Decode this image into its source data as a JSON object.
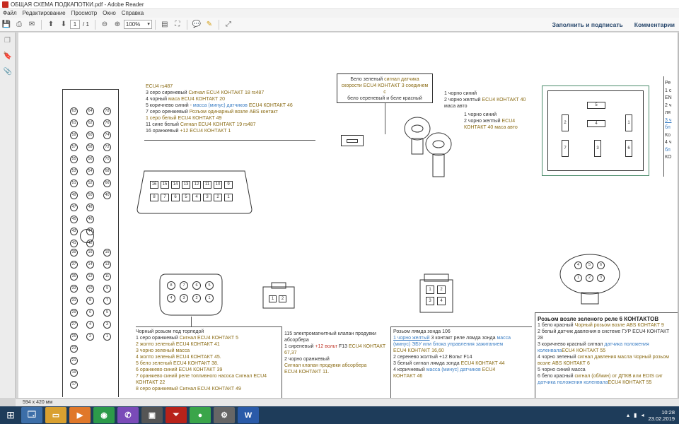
{
  "window": {
    "title": "ОБЩАЯ СХЕМА ПОДКАПОТКИ.pdf - Adobe Reader"
  },
  "menu": [
    "Файл",
    "Редактирование",
    "Просмотр",
    "Окно",
    "Справка"
  ],
  "toolbar": {
    "page_current": "1",
    "page_total": "/ 1",
    "zoom": "100%",
    "fill_sign": "Заполнить и подписать",
    "comments": "Комментарии"
  },
  "status": {
    "size": "594 x 420 мм"
  },
  "clock": {
    "time": "10:28",
    "date": "23.02.2019"
  },
  "doc": {
    "bigconn_left": [
      "63",
      "61",
      "59",
      "57",
      "55",
      "53",
      "51",
      "49",
      "47",
      "45",
      "43",
      "41"
    ],
    "bigconn_mid": [
      "64",
      "62",
      "60",
      "58",
      "56",
      "54",
      "52",
      "50",
      "48",
      "46",
      "44",
      "42"
    ],
    "bigconn_right": [
      "78",
      "76",
      "74",
      "72",
      "70",
      "68",
      "66",
      "40"
    ],
    "bigconn_lower_left": [
      "39",
      "37",
      "35",
      "33",
      "31",
      "29",
      "27",
      "25",
      "23",
      "21",
      "19",
      "17"
    ],
    "bigconn_lower_mid": [
      "16",
      "14",
      "12",
      "10",
      "8",
      "6",
      "4",
      "2"
    ],
    "bigconn_lower_right": [
      "15",
      "13",
      "11",
      "9",
      "7",
      "5",
      "3",
      "1"
    ],
    "ecu_block": {
      "l1": "ECU4  rs487",
      "l2a": "3 серо сиреневый ",
      "l2b": "Сигнал  ECU4 КОНТАКТ 18 rs487",
      "l3a": "4 чорный ",
      "l3b": "маса",
      "l3c": " ECU4 КОНТАКТ 20",
      "l4a": "5 коричнево синий - ",
      "l4b": "масса (минус) датчиков",
      "l4c": " ECU4 КОНТАКТ 46",
      "l5a": "7 серо оренжевый ",
      "l5b": "Розъом одинарный возле ABS контакт",
      "l6": "1 серо белый ECU4 КОНТАКТ 49",
      "l7a": "11 сине белый ",
      "l7b": "Сигнал  ECU4 КОНТАКТ 19 rs487",
      "l8a": "16 оранжевый ",
      "l8b": "+12 ECU4 КОНТАКТ 1"
    },
    "obd_top": [
      "16",
      "15",
      "14",
      "13",
      "12",
      "11",
      "10",
      "9"
    ],
    "obd_bottom": [
      "8",
      "7",
      "6",
      "5",
      "4",
      "3",
      "2",
      "1"
    ],
    "sensor_box": {
      "l1a": "Бело зеленый ",
      "l1b": "сигнал датчика",
      "l2": "скорости ECU4 КОНТАКТ 3 соединем с",
      "l3": "бело сереневый и беле красный"
    },
    "mass_block1": {
      "l1": "1 чорно синий",
      "l2a": "2 чорно желтый ",
      "l2b": "ECU4 КОНТАКТ 40",
      "l3": "маса авто"
    },
    "mass_block2": {
      "l1": "1 чорно синий",
      "l2a": "2 чорно желтый ",
      "l2b": "ECU4",
      "l3": "КОНТАКТ 40 маса авто"
    },
    "relay_pins": [
      "5",
      "2",
      "4",
      "1",
      "7",
      "3",
      "6"
    ],
    "right_edge": [
      "Ре",
      "1 с",
      "EN",
      "2 ч",
      "ля",
      "3 ч",
      "бл",
      "Ко",
      "4 ч",
      "бл",
      "КО"
    ],
    "chorny_pins_top": [
      "8",
      "7",
      "6",
      "5"
    ],
    "chorny_pins_bottom": [
      "4",
      "3",
      "2",
      "1"
    ],
    "chorny_block": {
      "title": "Чорный розьом под торпедой",
      "l1a": "1 серо оранжевый  ",
      "l1b": "Сигнал  ECU4 КОНТАКТ 5",
      "l2": "2 жолто зеленый  ECU4 КОНТАКТ 41",
      "l3": "3 чорно зеленый  масса",
      "l4": "4 жолто зеленый ECU4 КОНТАКТ 45.",
      "l5": "5 бело зеленый ECU4 КОНТАКТ 38.",
      "l6": "6 оранжево синий ECU4 КОНТАКТ 39",
      "l7": "7 оранжево синий реле топливного насоса Сигнал  ECU4",
      "l7b": "КОНТАКТ 22",
      "l8": "8 серо оранжевый Сигнал  ECU4 КОНТАКТ 49"
    },
    "valve_pins": [
      "1",
      "2"
    ],
    "valve_block": {
      "l1": "115 электромагнитный клапан продувки",
      "l2": "абсорбера",
      "l3a": "1 сиреневый ",
      "l3b": "+12 вольт",
      "l3c": "  F13 ",
      "l3d": "ECU4 КОНТАКТ",
      "l4": "67,37",
      "l5": "2 чорно оранжевый",
      "l6": "Сигнал клапан продувки абсорбера",
      "l7": " ECU4 КОНТАКТ 11."
    },
    "lambda_pins": [
      "1",
      "2",
      "3",
      "4"
    ],
    "lambda_block": {
      "title": "Розьом лямда зонда 106",
      "l1a": "1 чорно желтый",
      "l1b": " 3 контакт реле лямда зонда ",
      "l1c": "масса",
      "l2": "(минус) ЭБУ или блока управления зажиганием",
      "l3": "ECU4 КОНТАКТ 16,60",
      "l4": "2 серенево жолтый +12 Вольт F14",
      "l5a": "3 белый  сигнал лямда зонда ",
      "l5b": "ECU4 КОНТАКТ 44",
      "l6a": "4 коричневый  ",
      "l6b": "масса (минус) датчиков",
      "l6c": " ECU4",
      "l7": "КОНТАКТ 46"
    },
    "green_pins_top": [
      "4",
      "5",
      "6"
    ],
    "green_pins_bottom": [
      "1",
      "2",
      "3"
    ],
    "green_block": {
      "title": "Розьом возле зеленого реле 6 КОНТАКТОВ",
      "l1a": "1 бело красный ",
      "l1b": "Чорный розьом возле ABS КОНТАКТ",
      "l1c": "  9",
      "l2": "2 белый датчик давления в системе ГУР ECU4 КОНТАКТ",
      "l2b": "28",
      "l3a": "3 коричнево красный сигнал ",
      "l3b": "датчика положения",
      "l4a": "коленвала",
      "l4b": "ECU4 КОНТАКТ  55",
      "l5a": "4 чорно зеленый ",
      "l5b": "сигнал давления масла Чорный розьом",
      "l6": "возле ABS  КОНТАКТ 6",
      "l7": "5 чорно синий масса",
      "l8a": "6 бело красный ",
      "l8b": "сигнал (об/мин) от ДПКВ или EDIS сиг",
      "l9a": "датчика положения коленвала",
      "l9b": "ECU4 КОНТАКТ  55"
    }
  }
}
